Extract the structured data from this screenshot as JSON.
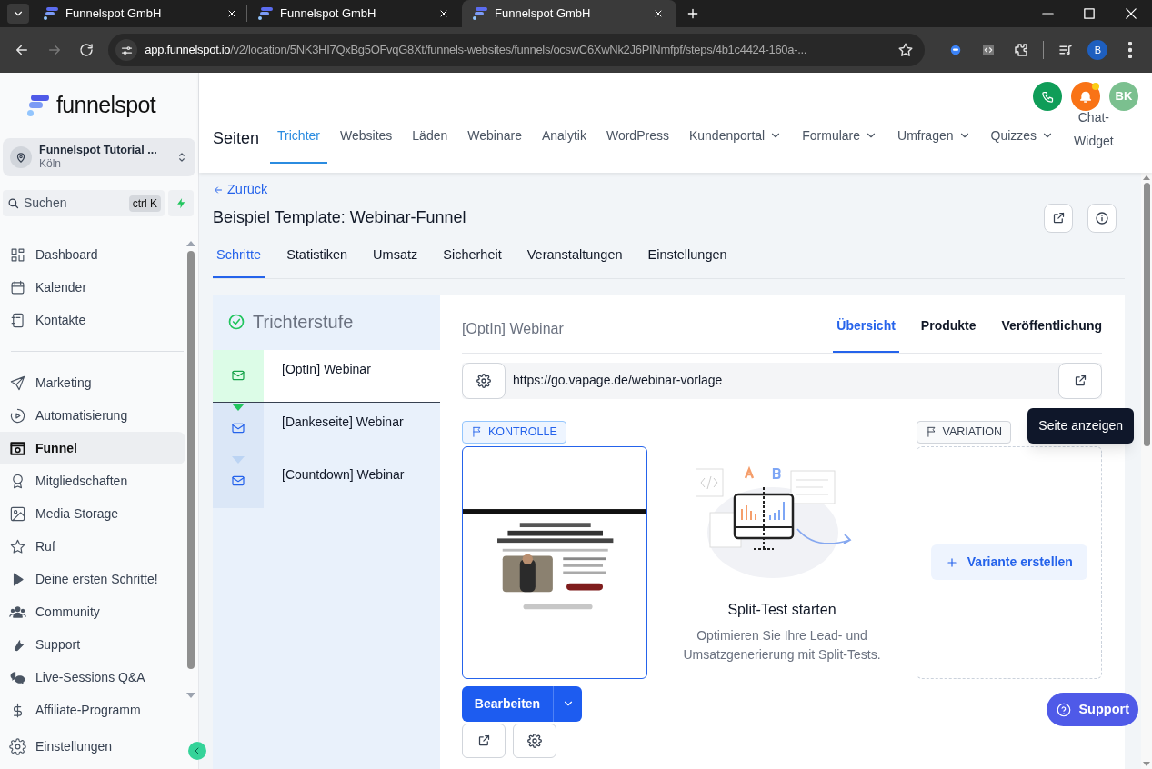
{
  "browser": {
    "tabs": [
      {
        "title": "Funnelspot GmbH",
        "selected": false
      },
      {
        "title": "Funnelspot GmbH",
        "selected": false
      },
      {
        "title": "Funnelspot GmbH",
        "selected": true
      }
    ],
    "url": {
      "host": "app.funnelspot.io",
      "path": "/v2/location/5NK3HI7QxBg5OFvqG8Xt/funnels-websites/funnels/ocswC6XwNk2J6PINmfpf/steps/4b1c4424-160a-..."
    },
    "profile": "B"
  },
  "sidebar": {
    "logo": "funnelspot",
    "account": {
      "name": "Funnelspot Tutorial ...",
      "location": "Köln"
    },
    "search": {
      "placeholder": "Suchen",
      "shortcut": "ctrl K"
    },
    "groups": [
      [
        {
          "label": "Dashboard",
          "selected": false
        },
        {
          "label": "Kalender",
          "selected": false
        },
        {
          "label": "Kontakte",
          "selected": false
        }
      ],
      [
        {
          "label": "Marketing",
          "selected": false
        },
        {
          "label": "Automatisierung",
          "selected": false
        },
        {
          "label": "Funnel",
          "selected": true
        },
        {
          "label": "Mitgliedschaften",
          "selected": false
        },
        {
          "label": "Media Storage",
          "selected": false
        },
        {
          "label": "Ruf",
          "selected": false
        },
        {
          "label": "Deine ersten Schritte!",
          "selected": false
        },
        {
          "label": "Community",
          "selected": false
        },
        {
          "label": "Support",
          "selected": false
        },
        {
          "label": "Live-Sessions Q&A",
          "selected": false
        },
        {
          "label": "Affiliate-Programm",
          "selected": false
        }
      ]
    ],
    "bottom_item": "Einstellungen"
  },
  "header": {
    "avatar": "BK",
    "notification_dot": true,
    "title": "Seiten",
    "nav": [
      {
        "label": "Trichter",
        "selected": true,
        "dropdown": false
      },
      {
        "label": "Websites",
        "selected": false,
        "dropdown": false
      },
      {
        "label": "Läden",
        "selected": false,
        "dropdown": false
      },
      {
        "label": "Webinare",
        "selected": false,
        "dropdown": false
      },
      {
        "label": "Analytik",
        "selected": false,
        "dropdown": false
      },
      {
        "label": "WordPress",
        "selected": false,
        "dropdown": false
      },
      {
        "label": "Kundenportal",
        "selected": false,
        "dropdown": true
      },
      {
        "label": "Formulare",
        "selected": false,
        "dropdown": true
      },
      {
        "label": "Umfragen",
        "selected": false,
        "dropdown": true
      },
      {
        "label": "Quizzes",
        "selected": false,
        "dropdown": true
      },
      {
        "label": "Chat-Widget",
        "selected": false,
        "dropdown": false
      }
    ]
  },
  "page": {
    "back": "Zurück",
    "title": "Beispiel Template: Webinar-Funnel",
    "tabs": [
      {
        "label": "Schritte",
        "selected": true
      },
      {
        "label": "Statistiken",
        "selected": false
      },
      {
        "label": "Umsatz",
        "selected": false
      },
      {
        "label": "Sicherheit",
        "selected": false
      },
      {
        "label": "Veranstaltungen",
        "selected": false
      },
      {
        "label": "Einstellungen",
        "selected": false
      }
    ]
  },
  "steps": {
    "header": "Trichterstufe",
    "items": [
      {
        "name": "[OptIn] Webinar",
        "selected": true
      },
      {
        "name": "[Dankeseite] Webinar",
        "selected": false
      },
      {
        "name": "[Countdown] Webinar",
        "selected": false
      }
    ]
  },
  "detail": {
    "title": "[OptIn] Webinar",
    "tabs": [
      {
        "label": "Übersicht",
        "selected": true
      },
      {
        "label": "Produkte",
        "selected": false
      },
      {
        "label": "Veröffentlichung",
        "selected": false
      }
    ],
    "url": "https://go.vapage.de/webinar-vorlage",
    "tooltip": "Seite anzeigen",
    "control_badge": "KONTROLLE",
    "variation_badge": "VARIATION",
    "split_title": "Split-Test starten",
    "split_text": "Optimieren Sie Ihre Lead- und Umsatzgenerierung mit Split-Tests.",
    "create_variant": "Variante erstellen",
    "edit": "Bearbeiten"
  },
  "support": "Support"
}
